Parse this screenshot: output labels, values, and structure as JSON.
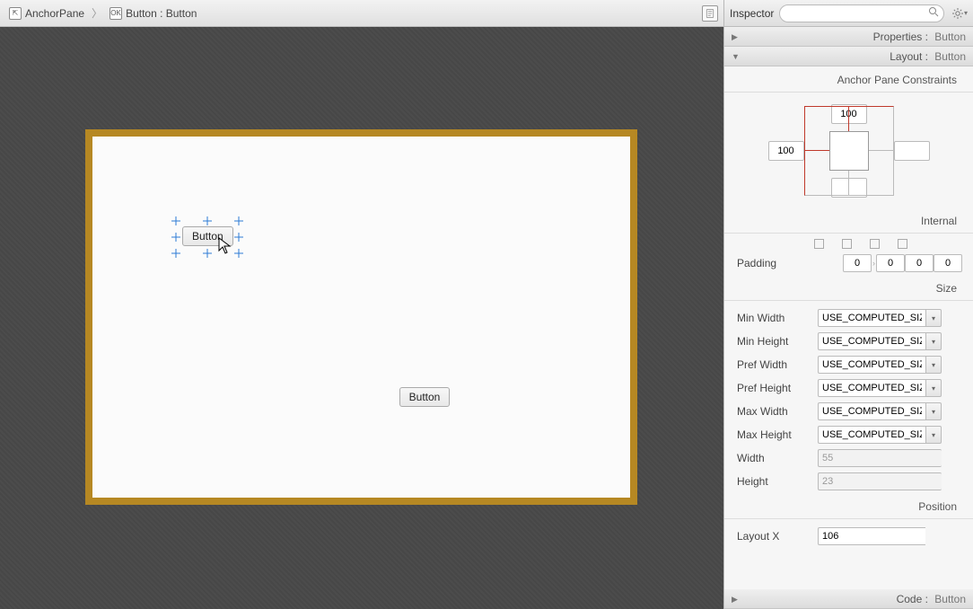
{
  "breadcrumb": {
    "item1": "AnchorPane",
    "item2": "Button : Button",
    "icon1": "⇱",
    "icon2": "OK"
  },
  "canvas": {
    "button1_label": "Button",
    "button2_label": "Button"
  },
  "inspector": {
    "title": "Inspector",
    "search_placeholder": "",
    "sections": {
      "properties": {
        "label": "Properties",
        "value": "Button"
      },
      "layout": {
        "label": "Layout",
        "value": "Button"
      },
      "code": {
        "label": "Code",
        "value": "Button"
      }
    },
    "anchor": {
      "group_title": "Anchor Pane Constraints",
      "top": "100",
      "left": "100",
      "right": "",
      "bottom": ""
    },
    "internal_title": "Internal",
    "padding": {
      "label": "Padding",
      "top": "0",
      "right": "0",
      "bottom": "0",
      "left": "0"
    },
    "size_title": "Size",
    "size": {
      "min_width_label": "Min Width",
      "min_width": "USE_COMPUTED_SIZE",
      "min_height_label": "Min Height",
      "min_height": "USE_COMPUTED_SIZE",
      "pref_width_label": "Pref Width",
      "pref_width": "USE_COMPUTED_SIZE",
      "pref_height_label": "Pref Height",
      "pref_height": "USE_COMPUTED_SIZE",
      "max_width_label": "Max Width",
      "max_width": "USE_COMPUTED_SIZE",
      "max_height_label": "Max Height",
      "max_height": "USE_COMPUTED_SIZE",
      "width_label": "Width",
      "width": "55",
      "height_label": "Height",
      "height": "23"
    },
    "position_title": "Position",
    "layout_x_label": "Layout X",
    "layout_x": "106"
  }
}
